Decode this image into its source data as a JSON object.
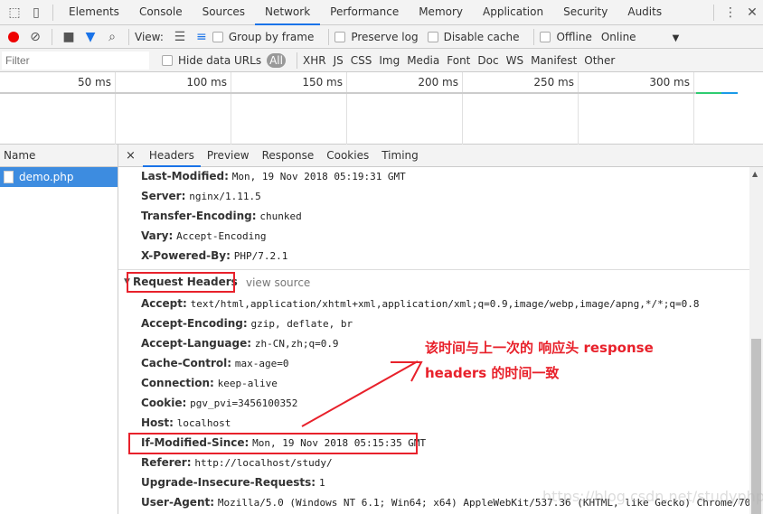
{
  "tabs": [
    "Elements",
    "Console",
    "Sources",
    "Network",
    "Performance",
    "Memory",
    "Application",
    "Security",
    "Audits"
  ],
  "active_tab": "Network",
  "toolbar": {
    "view_label": "View:",
    "group_by_frame": "Group by frame",
    "preserve_log": "Preserve log",
    "disable_cache": "Disable cache",
    "offline": "Offline",
    "throttle": "Online"
  },
  "filter": {
    "placeholder": "Filter",
    "hide_data_urls": "Hide data URLs",
    "types": [
      "All",
      "XHR",
      "JS",
      "CSS",
      "Img",
      "Media",
      "Font",
      "Doc",
      "WS",
      "Manifest",
      "Other"
    ]
  },
  "timeline": {
    "ticks": [
      "50 ms",
      "100 ms",
      "150 ms",
      "200 ms",
      "250 ms",
      "300 ms"
    ]
  },
  "requests": {
    "header": "Name",
    "items": [
      "demo.php"
    ]
  },
  "detail_tabs": [
    "Headers",
    "Preview",
    "Response",
    "Cookies",
    "Timing"
  ],
  "response_headers": [
    {
      "k": "Last-Modified:",
      "v": "Mon, 19 Nov 2018 05:19:31 GMT"
    },
    {
      "k": "Server:",
      "v": "nginx/1.11.5"
    },
    {
      "k": "Transfer-Encoding:",
      "v": "chunked"
    },
    {
      "k": "Vary:",
      "v": "Accept-Encoding"
    },
    {
      "k": "X-Powered-By:",
      "v": "PHP/7.2.1"
    }
  ],
  "request_section": {
    "title": "Request Headers",
    "view_source": "view source"
  },
  "request_headers": [
    {
      "k": "Accept:",
      "v": "text/html,application/xhtml+xml,application/xml;q=0.9,image/webp,image/apng,*/*;q=0.8"
    },
    {
      "k": "Accept-Encoding:",
      "v": "gzip, deflate, br"
    },
    {
      "k": "Accept-Language:",
      "v": "zh-CN,zh;q=0.9"
    },
    {
      "k": "Cache-Control:",
      "v": "max-age=0"
    },
    {
      "k": "Connection:",
      "v": "keep-alive"
    },
    {
      "k": "Cookie:",
      "v": "pgv_pvi=3456100352"
    },
    {
      "k": "Host:",
      "v": "localhost"
    },
    {
      "k": "If-Modified-Since:",
      "v": "Mon, 19 Nov 2018 05:15:35 GMT"
    },
    {
      "k": "Referer:",
      "v": "http://localhost/study/"
    },
    {
      "k": "Upgrade-Insecure-Requests:",
      "v": "1"
    },
    {
      "k": "User-Agent:",
      "v": "Mozilla/5.0 (Windows NT 6.1; Win64; x64) AppleWebKit/537.36 (KHTML, like Gecko) Chrome/70."
    }
  ],
  "annotation": {
    "line1": "该时间与上一次的 响应头 response",
    "line2": "headers 的时间一致",
    "color": "#e8212b"
  },
  "watermark": "https://blog.csdn.net/studyphp123"
}
